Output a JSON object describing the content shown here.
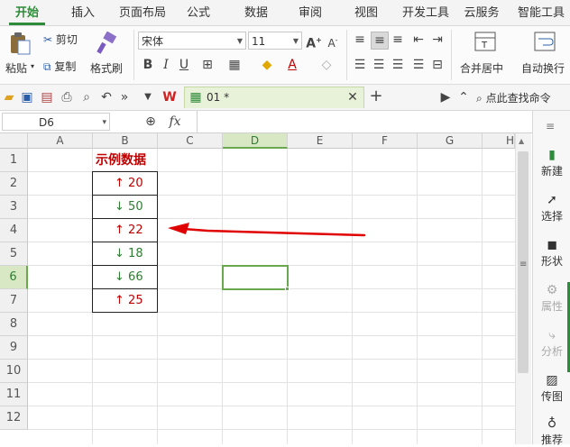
{
  "menu": {
    "tabs": [
      {
        "label": "开始",
        "active": true
      },
      {
        "label": "插入"
      },
      {
        "label": "页面布局"
      },
      {
        "label": "公式"
      },
      {
        "label": "数据"
      },
      {
        "label": "审阅"
      },
      {
        "label": "视图"
      },
      {
        "label": "开发工具"
      },
      {
        "label": "云服务"
      },
      {
        "label": "智能工具"
      }
    ]
  },
  "ribbon": {
    "paste_label": "粘贴",
    "cut_label": "剪切",
    "copy_label": "复制",
    "format_painter_label": "格式刷",
    "font_name": "宋体",
    "font_size": "11",
    "bold": "B",
    "italic": "I",
    "underline": "U",
    "merge_center_label": "合并居中",
    "auto_wrap_label": "自动换行"
  },
  "quickbar": {
    "doc_tab_label": "01 *",
    "search_label": "点此查找命令"
  },
  "formula_bar": {
    "cell_ref": "D6",
    "fx_label": "fx",
    "formula": ""
  },
  "sheet": {
    "columns": [
      "A",
      "B",
      "C",
      "D",
      "E",
      "F",
      "G",
      "H"
    ],
    "selected_column": "D",
    "rows": [
      "1",
      "2",
      "3",
      "4",
      "5",
      "6",
      "7",
      "8",
      "9",
      "10",
      "11",
      "12"
    ],
    "selected_row": "6",
    "header_cell": "示例数据",
    "data": [
      {
        "arrow": "↑",
        "value": "20",
        "dir": "up"
      },
      {
        "arrow": "↓",
        "value": "50",
        "dir": "down"
      },
      {
        "arrow": "↑",
        "value": "22",
        "dir": "up"
      },
      {
        "arrow": "↓",
        "value": "18",
        "dir": "down"
      },
      {
        "arrow": "↓",
        "value": "66",
        "dir": "down"
      },
      {
        "arrow": "↑",
        "value": "25",
        "dir": "up"
      }
    ]
  },
  "right_panel": {
    "items": [
      {
        "label": "新建",
        "icon": "new-doc-icon"
      },
      {
        "label": "选择",
        "icon": "select-cursor-icon"
      },
      {
        "label": "形状",
        "icon": "shape-icon"
      },
      {
        "label": "属性",
        "icon": "properties-icon",
        "disabled": true
      },
      {
        "label": "分析",
        "icon": "analysis-icon",
        "disabled": true
      },
      {
        "label": "传图",
        "icon": "upload-image-icon"
      },
      {
        "label": "推荐",
        "icon": "recommend-icon"
      }
    ]
  },
  "colors": {
    "accent": "#2e8b3a",
    "up": "#c00000",
    "down": "#2e7d32",
    "selection": "#6aa84f",
    "annotation_arrow": "#e00000"
  }
}
